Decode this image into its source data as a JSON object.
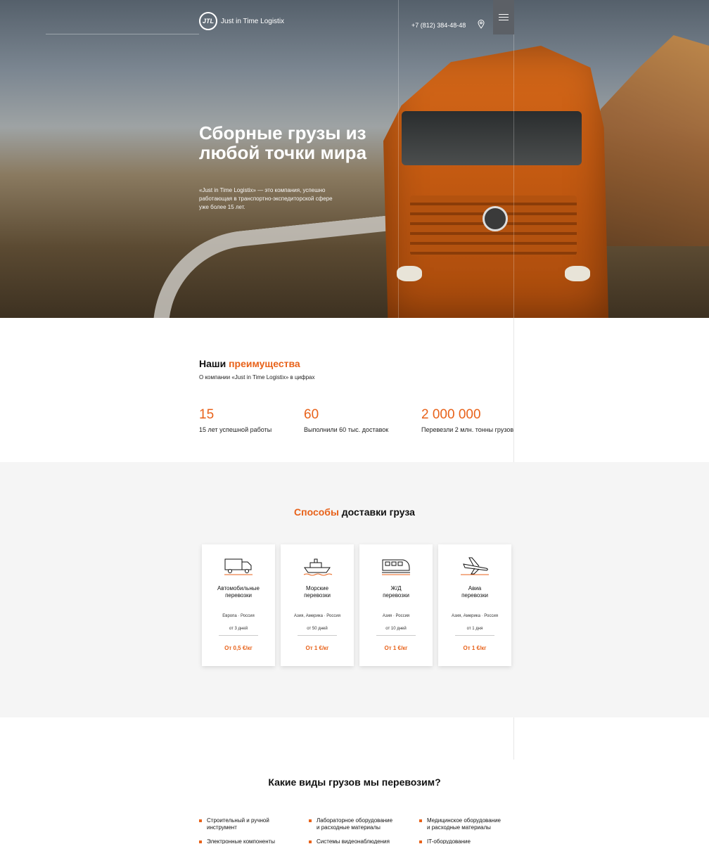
{
  "header": {
    "brand_mark": "JTL",
    "brand_name": "Just in Time Logistix",
    "phone": "+7 (812) 384-48-48",
    "icons": {
      "location": "map-pin-icon",
      "menu": "hamburger-menu-icon"
    }
  },
  "hero": {
    "title": "Сборные грузы из любой точки мира",
    "subtitle": "«Just in Time Logistix» — это компания, успешно работающая в транспортно-экспедиторской сфере уже более 15 лет."
  },
  "advantages": {
    "title_plain": "Наши ",
    "title_accent": "преимущества",
    "subtitle": "О компании «Just in Time Logistix» в цифрах",
    "stats": [
      {
        "value": "15",
        "label": "15 лет успешной работы"
      },
      {
        "value": "60",
        "label": "Выполнили 60 тыс. доставок"
      },
      {
        "value": "2 000 000",
        "label": "Перевезли 2 млн. тонны грузов"
      }
    ]
  },
  "delivery": {
    "title_accent": "Способы",
    "title_plain": " доставки груза",
    "cards": [
      {
        "icon": "truck-icon",
        "name_line1": "Автомобильные",
        "name_line2": "перевозки",
        "regions": "Европа · Россия",
        "time": "от 3 дней",
        "price": "От 0,5 €/кг"
      },
      {
        "icon": "ship-icon",
        "name_line1": "Морские",
        "name_line2": "перевозки",
        "regions": "Азия, Америка · Россия",
        "time": "от 50 дней",
        "price": "От 1 €/кг"
      },
      {
        "icon": "train-icon",
        "name_line1": "Ж/Д",
        "name_line2": "перевозки",
        "regions": "Азия · Россия",
        "time": "от 10 дней",
        "price": "От 1 €/кг"
      },
      {
        "icon": "plane-icon",
        "name_line1": "Авиа",
        "name_line2": "перевозки",
        "regions": "Азия, Америка · Россия",
        "time": "от 1 дня",
        "price": "От 1 €/кг"
      }
    ]
  },
  "cargo": {
    "title": "Какие виды грузов мы перевозим?",
    "items": [
      {
        "line1": "Строительный и ручной",
        "line2": "инструмент"
      },
      {
        "line1": "Лабораторное оборудование",
        "line2": "и расходные материалы"
      },
      {
        "line1": "Медицинское оборудование",
        "line2": "и расходные материалы"
      },
      {
        "line1": "Электронные компоненты",
        "line2": ""
      },
      {
        "line1": "Системы видеонаблюдения",
        "line2": ""
      },
      {
        "line1": "IT-оборудование",
        "line2": ""
      }
    ]
  },
  "colors": {
    "accent": "#e8621a",
    "menu_bg": "#5c6066",
    "section_gray": "#f5f5f5"
  }
}
